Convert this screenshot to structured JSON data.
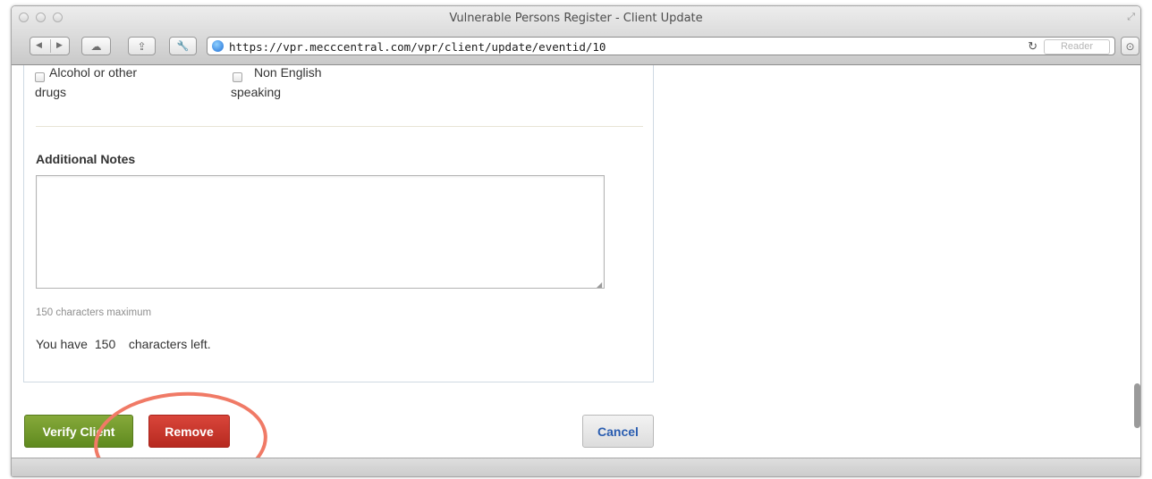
{
  "window": {
    "title": "Vulnerable Persons Register - Client Update",
    "url": "https://vpr.mecccentral.com/vpr/client/update/eventid/10",
    "reader_label": "Reader"
  },
  "icons": {
    "back": "◀",
    "forward": "▶",
    "cloud": "☁",
    "share": "⇪",
    "tools": "🔧",
    "reload": "↻",
    "downloads": "⊙",
    "fullscreen": "⤢"
  },
  "checkboxes": [
    {
      "line1": "Alcohol or other",
      "line2": "drugs",
      "checked": false
    },
    {
      "line1": "Non English",
      "line2": "speaking",
      "checked": false
    }
  ],
  "notes": {
    "heading": "Additional Notes",
    "value": "",
    "help_text": "150 characters maximum",
    "count_prefix": "You have",
    "count_value": "150",
    "count_suffix": "characters left."
  },
  "buttons": {
    "verify": "Verify Client",
    "remove": "Remove",
    "cancel": "Cancel"
  },
  "colors": {
    "verify": "#6f9a28",
    "remove": "#c8342a",
    "cancel_text": "#2a5db0",
    "annotation": "#f07a66"
  }
}
